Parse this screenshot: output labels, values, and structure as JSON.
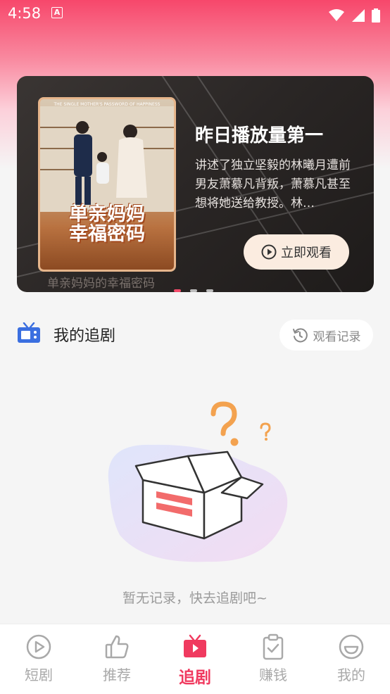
{
  "status_bar": {
    "time": "4:58",
    "notification_letter": "A"
  },
  "banner": {
    "poster_title_line1": "单亲妈妈",
    "poster_title_line2": "幸福密码",
    "poster_subtitle": "THE SINGLE MOTHER'S PASSWORD OF HAPPINESS",
    "title": "昨日播放量第一",
    "description": "讲述了独立坚毅的林曦月遭前男友萧慕凡背叛，萧慕凡甚至想将她送给教授。林…",
    "watch_button": "立即观看",
    "caption": "单亲妈妈的幸福密码",
    "active_slide": 1,
    "slide_count": 3
  },
  "section": {
    "title": "我的追剧",
    "history_button": "观看记录"
  },
  "empty_state": {
    "text": "暂无记录，快去追剧吧~"
  },
  "tabbar": {
    "items": [
      {
        "label": "短剧",
        "icon": "play-circle-icon",
        "active": false
      },
      {
        "label": "推荐",
        "icon": "thumbs-up-icon",
        "active": false
      },
      {
        "label": "追剧",
        "icon": "tv-icon",
        "active": true
      },
      {
        "label": "赚钱",
        "icon": "clipboard-check-icon",
        "active": false
      },
      {
        "label": "我的",
        "icon": "smile-icon",
        "active": false
      }
    ]
  },
  "colors": {
    "accent": "#f03a5f",
    "inactive": "#a9a9a9",
    "button_bg": "#fbece0"
  }
}
